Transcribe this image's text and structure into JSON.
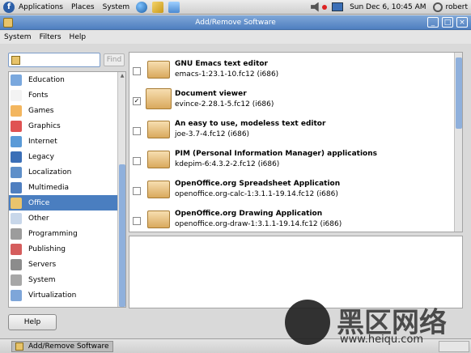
{
  "top_panel": {
    "menus": [
      "Applications",
      "Places",
      "System"
    ],
    "clock": "Sun Dec  6, 10:45 AM",
    "user": "robert"
  },
  "window": {
    "title": "Add/Remove Software"
  },
  "menu_bar": {
    "items": [
      "System",
      "Filters",
      "Help"
    ]
  },
  "search": {
    "value": "",
    "placeholder": "",
    "find_label": "Find"
  },
  "categories": [
    {
      "label": "Education",
      "icon": "education-icon",
      "color": "#7aa8de"
    },
    {
      "label": "Fonts",
      "icon": "font-icon",
      "color": "#f3f3f3"
    },
    {
      "label": "Games",
      "icon": "games-icon",
      "color": "#f3b65f"
    },
    {
      "label": "Graphics",
      "icon": "graphics-icon",
      "color": "#e05353"
    },
    {
      "label": "Internet",
      "icon": "internet-icon",
      "color": "#5a9ad7"
    },
    {
      "label": "Legacy",
      "icon": "legacy-icon",
      "color": "#3b6fb7"
    },
    {
      "label": "Localization",
      "icon": "localization-icon",
      "color": "#5e8fc9"
    },
    {
      "label": "Multimedia",
      "icon": "multimedia-icon",
      "color": "#4f7fc0"
    },
    {
      "label": "Office",
      "icon": "office-icon",
      "color": "#e9c46d"
    },
    {
      "label": "Other",
      "icon": "other-icon",
      "color": "#c8d7ea"
    },
    {
      "label": "Programming",
      "icon": "programming-icon",
      "color": "#9c9c9c"
    },
    {
      "label": "Publishing",
      "icon": "publishing-icon",
      "color": "#d55d5d"
    },
    {
      "label": "Servers",
      "icon": "servers-icon",
      "color": "#8c8c8c"
    },
    {
      "label": "System",
      "icon": "system-icon",
      "color": "#a7a7a7"
    },
    {
      "label": "Virtualization",
      "icon": "virtualization-icon",
      "color": "#7ea6d9"
    }
  ],
  "selected_category": "Office",
  "packages": [
    {
      "name": "GNU Emacs text editor",
      "version": "emacs-1:23.1-10.fc12 (i686)",
      "checked": false
    },
    {
      "name": "Document viewer",
      "version": "evince-2.28.1-5.fc12 (i686)",
      "checked": true
    },
    {
      "name": "An easy to use, modeless text editor",
      "version": "joe-3.7-4.fc12 (i686)",
      "checked": false
    },
    {
      "name": "PIM (Personal Information Manager) applications",
      "version": "kdepim-6:4.3.2-2.fc12 (i686)",
      "checked": false
    },
    {
      "name": "OpenOffice.org Spreadsheet Application",
      "version": "openoffice.org-calc-1:3.1.1-19.14.fc12 (i686)",
      "checked": false
    },
    {
      "name": "OpenOffice.org Drawing Application",
      "version": "openoffice.org-draw-1:3.1.1-19.14.fc12 (i686)",
      "checked": false
    }
  ],
  "buttons": {
    "help": "Help"
  },
  "taskbar": {
    "task_label": "Add/Remove Software"
  },
  "watermark": {
    "text": "黑区网络",
    "url": "www.heiqu.com"
  }
}
